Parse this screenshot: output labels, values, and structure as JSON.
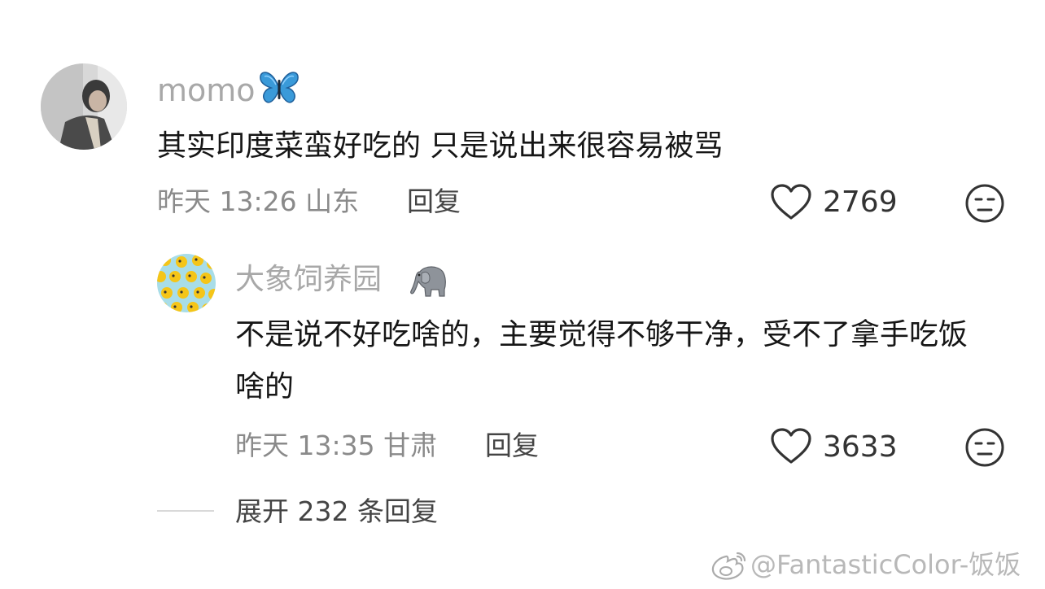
{
  "comments": [
    {
      "username": "momo",
      "badge_icon": "butterfly-icon",
      "text": "其实印度菜蛮好吃的 只是说出来很容易被骂",
      "time": "昨天 13:26",
      "location": "山东",
      "reply_label": "回复",
      "likes": "2769"
    }
  ],
  "replies": [
    {
      "username": "大象饲养园",
      "badge_icon": "elephant-icon",
      "text": "不是说不好吃啥的，主要觉得不够干净，受不了拿手吃饭啥的",
      "time": "昨天 13:35",
      "location": "甘肃",
      "reply_label": "回复",
      "likes": "3633"
    }
  ],
  "expand_label": "展开 232 条回复",
  "watermark": "@FantasticColor-饭饭",
  "colors": {
    "text": "#161616",
    "muted": "#8a8a8a",
    "username": "#a8a8a8",
    "butterfly": "#3a9ad9"
  }
}
